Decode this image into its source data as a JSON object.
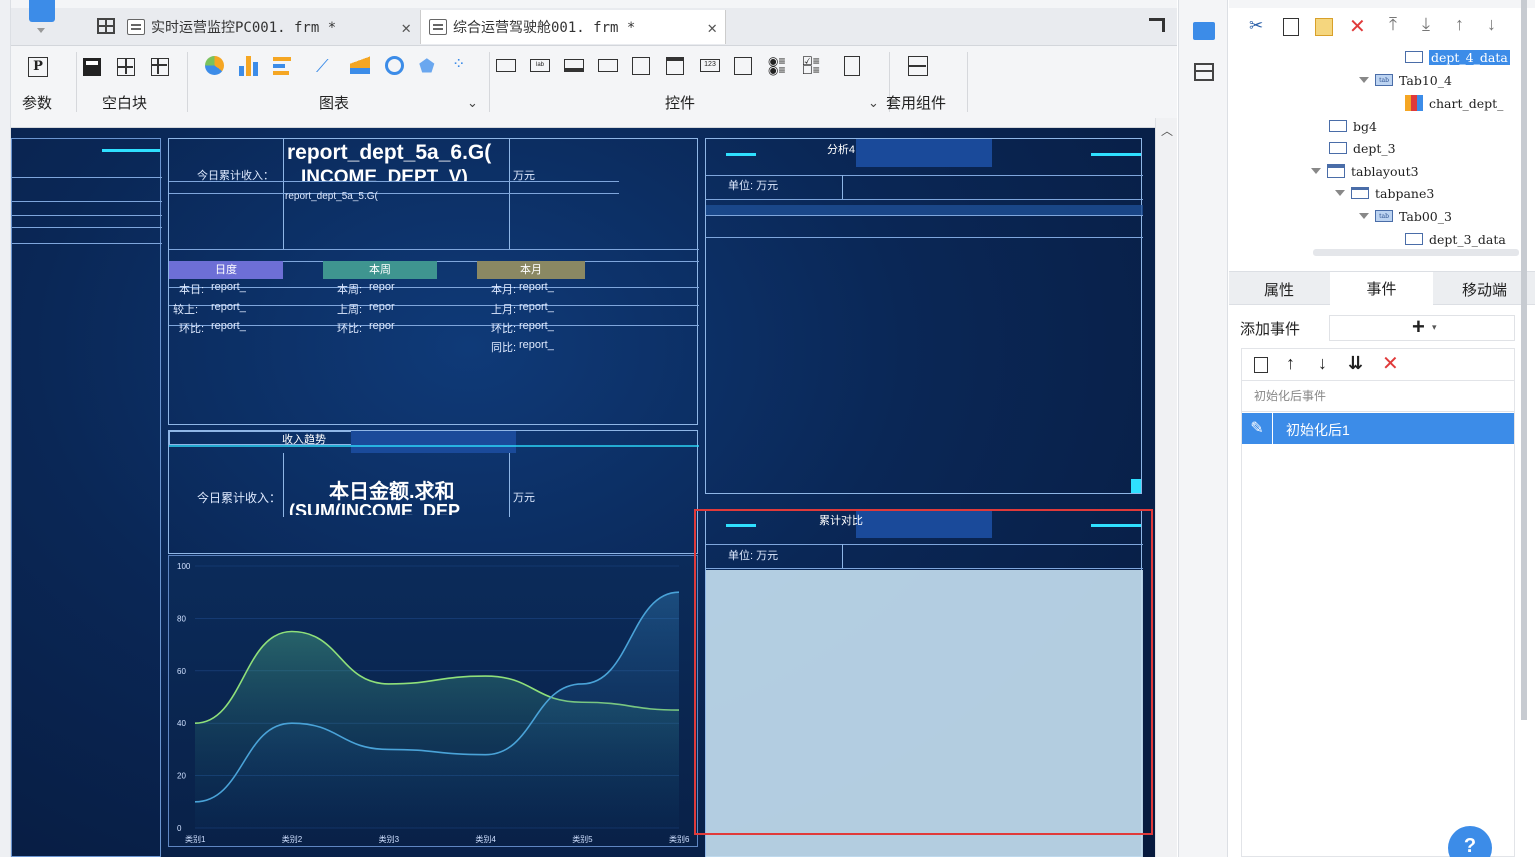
{
  "tabs": [
    {
      "label": "实时运营监控PC001. frm *"
    },
    {
      "label": "综合运营驾驶舱001. frm *"
    }
  ],
  "toolbar": {
    "groups": [
      {
        "label": "参数"
      },
      {
        "label": "空白块"
      },
      {
        "label": "图表"
      },
      {
        "label": "控件"
      },
      {
        "label": "套用组件"
      }
    ]
  },
  "canvas": {
    "big_value": "report_dept_5a_6.G(",
    "big_value2": "INCOME_DEPT_V)",
    "today_label": "今日累计收入：",
    "unit_wan": "万元",
    "cols": [
      {
        "head": "日度",
        "rows": [
          "本日:",
          "较上:",
          "环比:"
        ],
        "val": "report_"
      },
      {
        "head": "本周",
        "rows": [
          "本周:",
          "上周:",
          "环比:"
        ],
        "val": "repor"
      },
      {
        "head": "本月",
        "rows": [
          "本月:",
          "上月:",
          "环比:",
          "同比:"
        ],
        "val": "report_"
      }
    ],
    "income_trend_title": "收入趋势",
    "sum_title": "本日金额.求和",
    "sum_sub": "(SUM(INCOME_DEP",
    "panel2_title": "分析4",
    "panel3_title": "累计对比",
    "unit_label": "单位: 万元",
    "y_ticks": [
      "100",
      "80",
      "60",
      "40",
      "20",
      "0"
    ],
    "x_ticks": [
      "类别1",
      "类别2",
      "类别3",
      "类别4",
      "类别5",
      "类别6"
    ],
    "report_cell": "report_dept_5a_5.G("
  },
  "chart_data": {
    "type": "area",
    "categories": [
      "类别1",
      "类别2",
      "类别3",
      "类别4",
      "类别5",
      "类别6"
    ],
    "series": [
      {
        "values": [
          40,
          75,
          55,
          58,
          48,
          45
        ]
      },
      {
        "values": [
          10,
          40,
          30,
          28,
          55,
          90
        ]
      }
    ],
    "ylim": [
      0,
      100
    ]
  },
  "tree": {
    "items": [
      {
        "label": "dept_4_data",
        "selected": true
      },
      {
        "label": "Tab10_4"
      },
      {
        "label": "chart_dept_"
      },
      {
        "label": "bg4"
      },
      {
        "label": "dept_3"
      },
      {
        "label": "tablayout3"
      },
      {
        "label": "tabpane3"
      },
      {
        "label": "Tab00_3"
      },
      {
        "label": "dept_3_data"
      }
    ]
  },
  "props": {
    "tabs": [
      "属性",
      "事件",
      "移动端"
    ],
    "add_event_label": "添加事件",
    "event_section": "初始化后事件",
    "event_item": "初始化后1",
    "help": "?"
  },
  "colors": {
    "accent": "#3c8ce8",
    "canvas": "#0a2350",
    "highlight": "#e03a3a"
  }
}
